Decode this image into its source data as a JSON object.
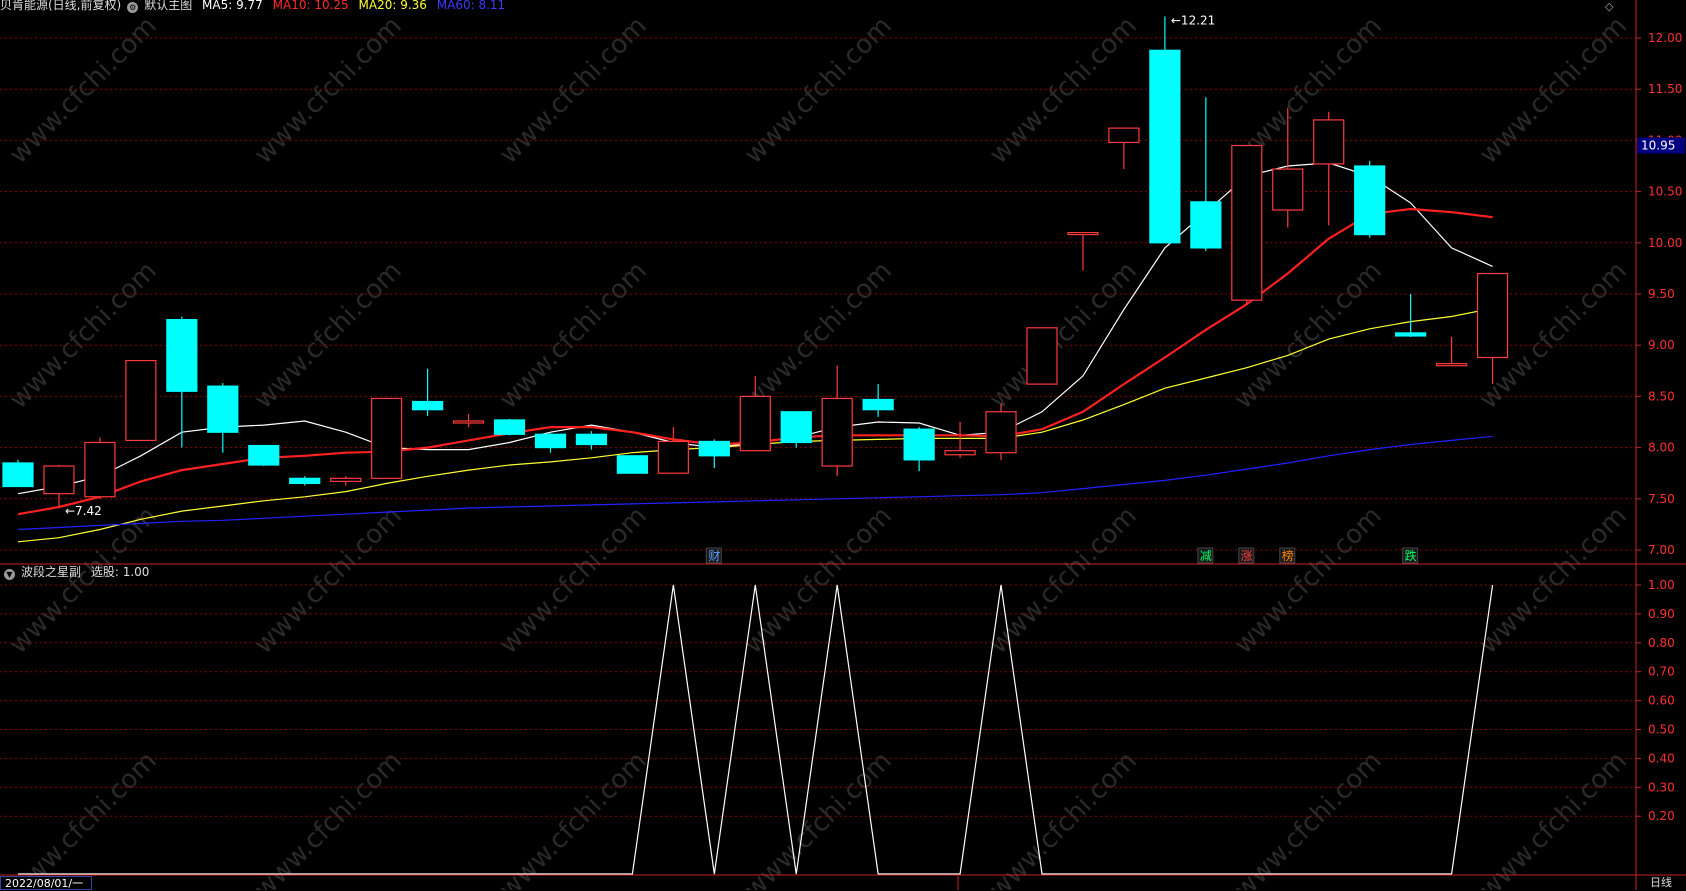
{
  "header": {
    "stock_name": "贝肯能源(日线,前复权)",
    "template_label": "默认主图",
    "ma5": "MA5: 9.77",
    "ma10": "MA10: 10.25",
    "ma20": "MA20: 9.36",
    "ma60": "MA60: 8.11"
  },
  "sub_header": {
    "indicator": "波段之星副",
    "select_value": "选股: 1.00"
  },
  "footer": {
    "date": "2022/08/01/一",
    "period": "日线"
  },
  "colors": {
    "up": "#ff3b3b",
    "down": "#00ffff",
    "ma5": "#ffffff",
    "ma10": "#ff2020",
    "ma20": "#ffff33",
    "ma60": "#2222ff",
    "grid": "#8b0000",
    "axis": "#cc2222"
  },
  "watermark": "www.cfchi.com",
  "chart_data": [
    {
      "type": "candlestick",
      "title": "贝肯能源(日线,前复权)",
      "y_ticks": [
        7.0,
        7.5,
        8.0,
        8.5,
        9.0,
        9.5,
        10.0,
        10.5,
        11.0,
        11.5,
        12.0
      ],
      "ylim": [
        6.95,
        12.25
      ],
      "current_price": "10.95",
      "high_label": "12.21",
      "low_label": "7.42",
      "candles": [
        [
          7.85,
          7.62,
          7.88,
          7.62
        ],
        [
          7.55,
          7.82,
          7.83,
          7.42
        ],
        [
          7.52,
          8.05,
          8.1,
          7.5
        ],
        [
          8.07,
          8.85,
          8.85,
          8.07
        ],
        [
          9.25,
          8.55,
          9.28,
          8.0
        ],
        [
          8.6,
          8.15,
          8.63,
          7.95
        ],
        [
          8.02,
          7.83,
          8.02,
          7.82
        ],
        [
          7.7,
          7.65,
          7.72,
          7.63
        ],
        [
          7.67,
          7.7,
          7.72,
          7.63
        ],
        [
          7.7,
          8.48,
          8.48,
          7.7
        ],
        [
          8.45,
          8.37,
          8.77,
          8.31
        ],
        [
          8.26,
          8.26,
          8.33,
          8.2
        ],
        [
          8.27,
          8.13,
          8.28,
          8.12
        ],
        [
          8.13,
          8.0,
          8.15,
          7.95
        ],
        [
          8.13,
          8.03,
          8.16,
          7.98
        ],
        [
          7.92,
          7.75,
          7.92,
          7.75
        ],
        [
          7.75,
          8.06,
          8.2,
          7.75
        ],
        [
          8.06,
          7.92,
          8.08,
          7.8
        ],
        [
          7.97,
          8.5,
          8.7,
          7.97
        ],
        [
          8.35,
          8.05,
          8.35,
          8.0
        ],
        [
          7.82,
          8.48,
          8.8,
          7.72
        ],
        [
          8.47,
          8.37,
          8.62,
          8.3
        ],
        [
          8.18,
          7.88,
          8.2,
          7.77
        ],
        [
          7.93,
          7.97,
          8.25,
          7.9
        ],
        [
          7.95,
          8.35,
          8.43,
          7.88
        ],
        [
          8.62,
          9.17,
          9.17,
          8.62
        ],
        [
          10.1,
          10.1,
          10.1,
          9.73
        ],
        [
          10.98,
          11.12,
          11.12,
          10.72
        ],
        [
          11.88,
          10.0,
          12.21,
          10.37
        ],
        [
          10.4,
          9.95,
          11.42,
          9.92
        ],
        [
          9.44,
          10.95,
          10.95,
          9.4
        ],
        [
          10.32,
          10.72,
          11.32,
          10.15
        ],
        [
          10.77,
          11.2,
          11.28,
          10.17
        ],
        [
          10.75,
          10.08,
          10.8,
          10.05
        ],
        [
          9.12,
          9.09,
          9.5,
          9.08
        ],
        [
          8.8,
          8.82,
          9.08,
          8.8
        ],
        [
          8.88,
          9.7,
          9.7,
          8.62
        ]
      ],
      "series": [
        {
          "name": "MA5",
          "values": [
            7.55,
            7.62,
            7.72,
            7.92,
            8.15,
            8.2,
            8.22,
            8.26,
            8.15,
            8.0,
            7.98,
            7.98,
            8.05,
            8.15,
            8.22,
            8.15,
            8.05,
            8.0,
            8.05,
            8.1,
            8.2,
            8.25,
            8.24,
            8.12,
            8.15,
            8.35,
            8.7,
            9.35,
            9.95,
            10.3,
            10.65,
            10.75,
            10.78,
            10.65,
            10.39,
            9.95,
            9.77
          ]
        },
        {
          "name": "MA10",
          "values": [
            7.35,
            7.42,
            7.52,
            7.67,
            7.78,
            7.84,
            7.9,
            7.92,
            7.95,
            7.96,
            8.0,
            8.07,
            8.14,
            8.2,
            8.2,
            8.15,
            8.08,
            8.03,
            8.05,
            8.1,
            8.12,
            8.12,
            8.12,
            8.12,
            8.11,
            8.18,
            8.35,
            8.62,
            8.88,
            9.15,
            9.4,
            9.7,
            10.04,
            10.28,
            10.33,
            10.3,
            10.25
          ]
        },
        {
          "name": "MA20",
          "values": [
            7.08,
            7.12,
            7.2,
            7.3,
            7.38,
            7.43,
            7.48,
            7.52,
            7.57,
            7.65,
            7.72,
            7.78,
            7.83,
            7.86,
            7.9,
            7.95,
            7.98,
            8.0,
            8.03,
            8.06,
            8.07,
            8.08,
            8.09,
            8.09,
            8.09,
            8.15,
            8.27,
            8.42,
            8.58,
            8.68,
            8.78,
            8.9,
            9.06,
            9.16,
            9.23,
            9.28,
            9.36
          ]
        },
        {
          "name": "MA60",
          "values": [
            7.2,
            7.22,
            7.24,
            7.26,
            7.28,
            7.29,
            7.31,
            7.33,
            7.35,
            7.37,
            7.39,
            7.41,
            7.42,
            7.43,
            7.44,
            7.45,
            7.46,
            7.47,
            7.48,
            7.49,
            7.5,
            7.51,
            7.52,
            7.53,
            7.54,
            7.56,
            7.6,
            7.64,
            7.68,
            7.73,
            7.79,
            7.85,
            7.92,
            7.98,
            8.03,
            8.07,
            8.11
          ]
        }
      ],
      "markers": [
        {
          "index": 17,
          "text": "财",
          "color": "#5aa0ff"
        },
        {
          "index": 29,
          "text": "减",
          "color": "#00ff66"
        },
        {
          "index": 30,
          "text": "涨",
          "color": "#ff4040"
        },
        {
          "index": 31,
          "text": "榜",
          "color": "#ff8800"
        },
        {
          "index": 34,
          "text": "跌",
          "color": "#00ff66"
        }
      ]
    },
    {
      "type": "line",
      "title": "波段之星副",
      "y_ticks": [
        0.2,
        0.3,
        0.4,
        0.5,
        0.6,
        0.7,
        0.8,
        0.9,
        1.0
      ],
      "ylim": [
        0,
        1.06
      ],
      "values": [
        0,
        0,
        0,
        0,
        0,
        0,
        0,
        0,
        0,
        0,
        0,
        0,
        0,
        0,
        0,
        0,
        1,
        0,
        1,
        0,
        1,
        0,
        0,
        0,
        1,
        0,
        0,
        0,
        0,
        0,
        0,
        0,
        0,
        0,
        0,
        0,
        1
      ]
    }
  ]
}
